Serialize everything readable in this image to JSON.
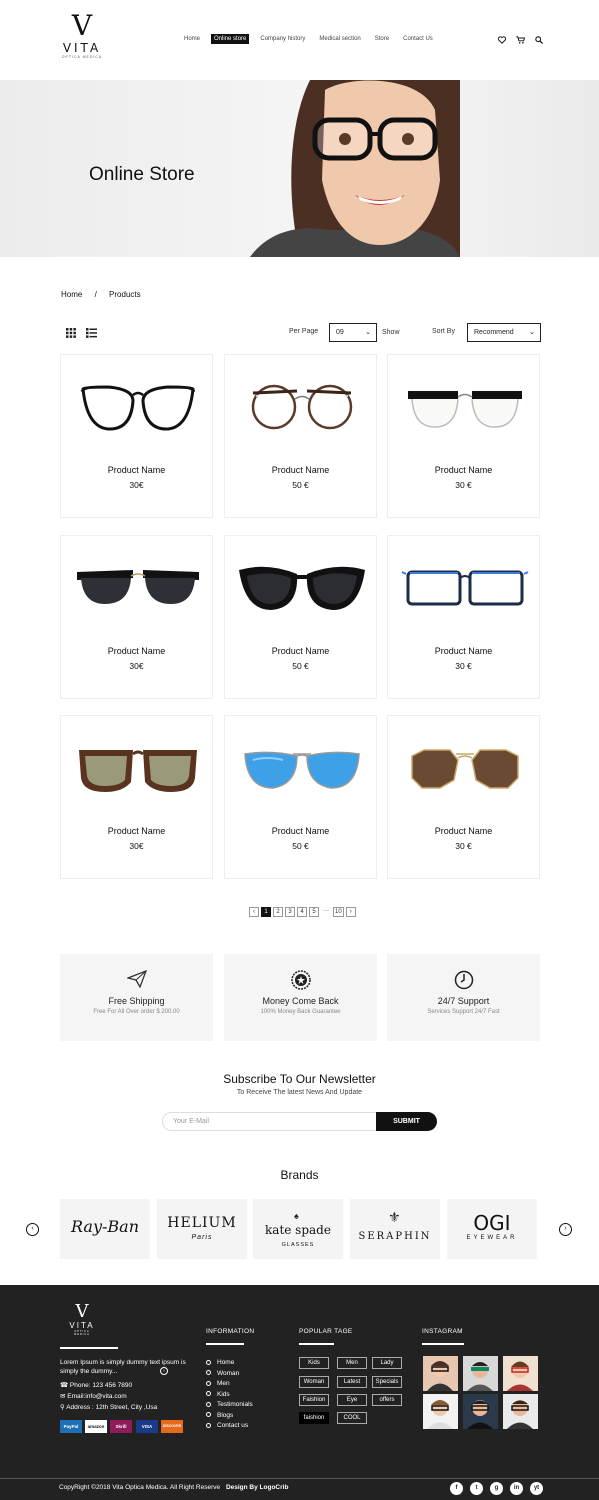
{
  "header": {
    "logo": {
      "mark": "V",
      "word": "VITA",
      "tag": "OPTICA MEDICA"
    },
    "nav": [
      "Home",
      "Online store",
      "Company history",
      "Medical section",
      "Store",
      "Contact Us"
    ],
    "icons": [
      "heart-icon",
      "cart-icon",
      "search-icon"
    ]
  },
  "hero": {
    "title": "Online Store"
  },
  "breadcrumb": {
    "home": "Home",
    "sep": "/",
    "current": "Products"
  },
  "toolbar": {
    "per_page_label": "Per Page",
    "per_page_value": "09",
    "show_label": "Show",
    "sort_label": "Sort By",
    "sort_value": "Recommend"
  },
  "products": [
    {
      "name": "Product Name",
      "price": "30€",
      "style": "clear-round"
    },
    {
      "name": "Product Name",
      "price": "50 €",
      "style": "brown-round"
    },
    {
      "name": "Product Name",
      "price": "30 €",
      "style": "clear-half"
    },
    {
      "name": "Product Name",
      "price": "30€",
      "style": "sun-clubmaster"
    },
    {
      "name": "Product Name",
      "price": "50 €",
      "style": "sun-cateye"
    },
    {
      "name": "Product Name",
      "price": "30 €",
      "style": "blue-rect"
    },
    {
      "name": "Product Name",
      "price": "30€",
      "style": "tortoise-square"
    },
    {
      "name": "Product Name",
      "price": "50 €",
      "style": "blue-aviator"
    },
    {
      "name": "Product Name",
      "price": "30 €",
      "style": "brown-hex"
    }
  ],
  "pager": {
    "prev": "‹",
    "pages": [
      "1",
      "2",
      "3",
      "4",
      "5",
      "···",
      "10"
    ],
    "next": "›",
    "current": "1"
  },
  "features": [
    {
      "title": "Free Shipping",
      "sub": "Free For All Over order $ 200.00",
      "icon": "paper-plane-icon"
    },
    {
      "title": "Money Come Back",
      "sub": "100% Money Back Guarantee",
      "icon": "badge-icon"
    },
    {
      "title": "24/7 Support",
      "sub": "Services Support 24/7 Fast",
      "icon": "clock-icon"
    }
  ],
  "newsletter": {
    "title": "Subscribe To Our Newsletter",
    "subtitle": "To Receive The latest News And Update",
    "placeholder": "Your E-Mail",
    "button": "SUBMIT"
  },
  "brands": {
    "title": "Brands",
    "items": [
      {
        "name": "Ray-Ban",
        "sub": ""
      },
      {
        "name": "HELIUM",
        "sub": "Paris"
      },
      {
        "name": "kate spade",
        "sub": "GLASSES"
      },
      {
        "name": "SERAPHIN",
        "sub": ""
      },
      {
        "name": "OGI",
        "sub": "EYEWEAR"
      }
    ]
  },
  "footer": {
    "about": "Lorem Ipsum is simply dummy text ipsum is simply the  dummy...",
    "phone": "Phone: 123 456 7890",
    "email": "Email:info@vita.com",
    "address": "Address : 12th Street, City ,Usa",
    "payments": [
      "PayPal",
      "amazon",
      "Skrill",
      "VISA",
      "DISCOVER"
    ],
    "information_title": "INFORMATION",
    "information": [
      "Home",
      "Woman",
      "Men",
      "Kids",
      "Testimonials",
      "Blogs",
      "Contact us"
    ],
    "tags_title": "POPULAR TAGE",
    "tags": [
      "Kids",
      "Men",
      "Lady",
      "Woman",
      "Latest",
      "Specials",
      "Faishion",
      "Eye",
      "offers",
      "faishion",
      "COOL"
    ],
    "instagram_title": "INSTAGRAM",
    "copyright": "CopyRight  ©2018 Vita Optica Medica. All Right Reserve",
    "design": "Design By LogoCrib",
    "social": [
      "f",
      "t",
      "g",
      "in",
      "yt"
    ]
  }
}
